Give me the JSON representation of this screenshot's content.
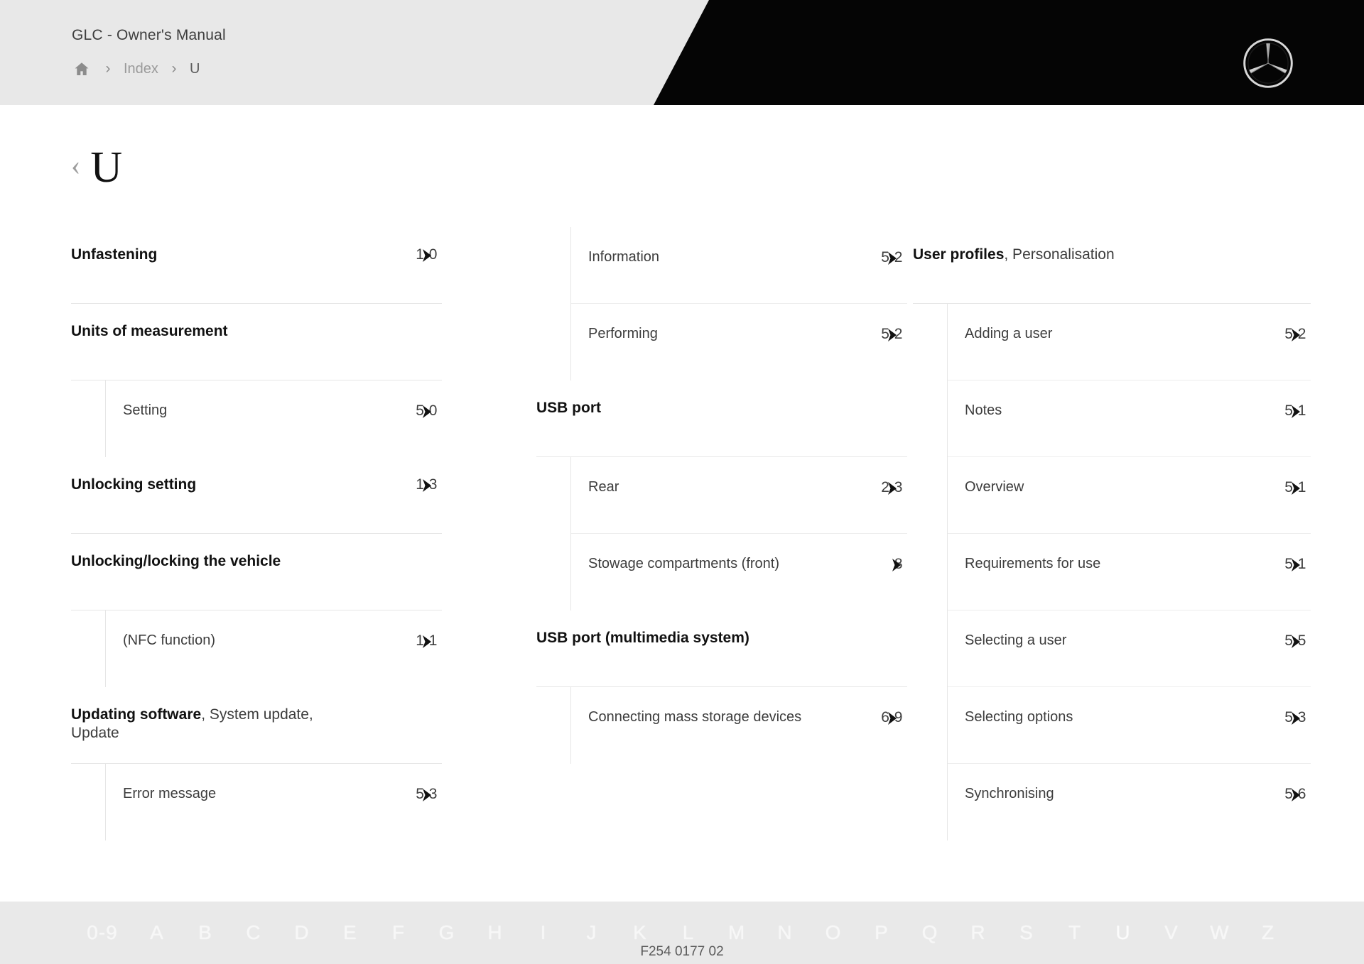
{
  "header": {
    "manual_title": "GLC - Owner's Manual",
    "breadcrumb": {
      "home_icon": "home-icon",
      "separator": "›",
      "items": [
        {
          "label": "Index",
          "current": false
        },
        {
          "label": "U",
          "current": true
        }
      ]
    },
    "logo": "mercedes-benz-star-icon"
  },
  "page": {
    "back_icon": "chevron-left-icon",
    "letter": "U"
  },
  "columns": [
    {
      "id": "column-1",
      "groups": [
        {
          "title": "Unfastening",
          "title_suffix": "",
          "page": "1 0",
          "chevron": "chevron-right-icon",
          "children": []
        },
        {
          "title": "Units of measurement",
          "title_suffix": "",
          "page": "",
          "chevron": "",
          "children": [
            {
              "label": "Setting",
              "page": "5 0",
              "chevron": "chevron-right-icon"
            }
          ]
        },
        {
          "title": "Unlocking setting",
          "title_suffix": "",
          "page": "1 3",
          "chevron": "chevron-right-icon",
          "children": []
        },
        {
          "title": "Unlocking/locking the vehicle",
          "title_suffix": "",
          "page": "",
          "chevron": "",
          "children": [
            {
              "label": "(NFC function)",
              "page": "1 1",
              "chevron": "chevron-right-icon"
            }
          ]
        },
        {
          "title": "Updating software",
          "title_suffix": ", System update, Update",
          "page": "",
          "chevron": "",
          "children": [
            {
              "label": "Error message",
              "page": "5 3",
              "chevron": "chevron-right-icon"
            }
          ]
        }
      ]
    },
    {
      "id": "column-2",
      "groups": [
        {
          "title": "",
          "title_suffix": "",
          "page": "",
          "chevron": "",
          "children": [
            {
              "label": "Information",
              "page": "5 2",
              "chevron": "chevron-right-icon"
            },
            {
              "label": "Performing",
              "page": "5 2",
              "chevron": "chevron-right-icon"
            }
          ]
        },
        {
          "title": "USB port",
          "title_suffix": "",
          "page": "",
          "chevron": "",
          "children": [
            {
              "label": "Rear",
              "page": "2 3",
              "chevron": "chevron-right-icon"
            },
            {
              "label": "Stowage compartments (front)",
              "page": " 8",
              "chevron": "chevron-right-icon"
            }
          ]
        },
        {
          "title": "USB port (multimedia system)",
          "title_suffix": "",
          "page": "",
          "chevron": "",
          "children": [
            {
              "label": "Connecting mass storage devices",
              "page": "6 9",
              "chevron": "chevron-right-icon"
            }
          ]
        }
      ]
    },
    {
      "id": "column-3",
      "groups": [
        {
          "title": "User profiles",
          "title_suffix": ", Personalisation",
          "page": "",
          "chevron": "",
          "children": [
            {
              "label": "Adding a user",
              "page": "5 2",
              "chevron": "chevron-right-icon"
            },
            {
              "label": "Notes",
              "page": "5 1",
              "chevron": "chevron-right-icon"
            },
            {
              "label": "Overview",
              "page": "5 1",
              "chevron": "chevron-right-icon"
            },
            {
              "label": "Requirements for use",
              "page": "5 1",
              "chevron": "chevron-right-icon"
            },
            {
              "label": "Selecting a user",
              "page": "5 5",
              "chevron": "chevron-right-icon"
            },
            {
              "label": "Selecting options",
              "page": "5 3",
              "chevron": "chevron-right-icon"
            },
            {
              "label": "Synchronising",
              "page": "5 6",
              "chevron": "chevron-right-icon"
            }
          ]
        }
      ]
    }
  ],
  "alphabet_bar": {
    "letters": [
      "0-9",
      "A",
      "B",
      "C",
      "D",
      "E",
      "F",
      "G",
      "H",
      "I",
      "J",
      "K",
      "L",
      "M",
      "N",
      "O",
      "P",
      "Q",
      "R",
      "S",
      "T",
      "U",
      "V",
      "W",
      "Z"
    ],
    "active": "U"
  },
  "footer": {
    "document_id": "F254 0177 02"
  },
  "colors": {
    "header_bg": "#e8e8e8",
    "header_black": "#050505",
    "page_bg": "#ffffff",
    "text_primary": "#111111",
    "text_secondary": "#3d3d3d",
    "text_muted": "#9a9a9a",
    "divider": "#e6e6e6",
    "alpha_bar_bg": "#e9e9e9",
    "alpha_letter": "#f7f7f7"
  }
}
